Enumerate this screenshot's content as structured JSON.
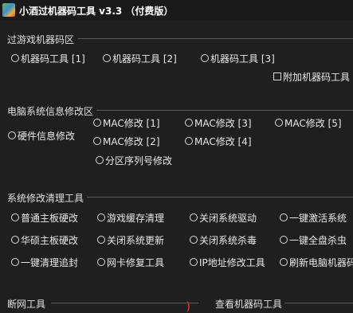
{
  "window": {
    "title": "小酒过机器码工具 v3.3 （付费版）"
  },
  "game_section": {
    "title": "过游戏机器码区",
    "options": [
      "机器码工具 [1]",
      "机器码工具 [2]",
      "机器码工具 [3]"
    ],
    "checkbox": "附加机器码工具"
  },
  "pc_section": {
    "title": "电脑系统信息修改区",
    "hardware": "硬件信息修改",
    "mac": [
      "MAC修改 [1]",
      "MAC修改 [3]",
      "MAC修改 [5]",
      "MAC修改 [2]",
      "MAC修改 [4]"
    ],
    "partition": "分区序列号修改"
  },
  "tools_section": {
    "title": "系统修改清理工具",
    "rows": [
      [
        "普通主板硬改",
        "游戏缓存清理",
        "关闭系统驱动",
        "一键激活系统"
      ],
      [
        "华硕主板硬改",
        "关闭系统更新",
        "关闭系统杀毒",
        "一键全盘杀虫"
      ],
      [
        "一键清理追封",
        "网卡修复工具",
        "IP地址修改工具",
        "刷新电脑机器码"
      ]
    ]
  },
  "bottom": {
    "left_title": "断网工具",
    "right_title": "查看机器码工具"
  }
}
